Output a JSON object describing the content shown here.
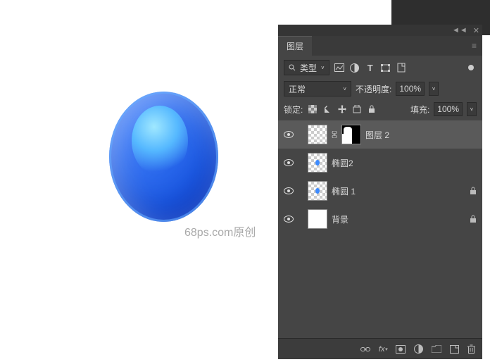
{
  "canvas": {
    "watermark": "68ps.com原创"
  },
  "panel": {
    "title": "图层",
    "filter": {
      "label": "类型",
      "icons": {
        "image": "image-filter-icon",
        "adjust": "adjustment-filter-icon",
        "text": "text-filter-icon",
        "shape": "shape-filter-icon",
        "smart": "smart-filter-icon"
      }
    },
    "blend": {
      "mode": "正常",
      "opacity_label": "不透明度:",
      "opacity_value": "100%"
    },
    "lock": {
      "label": "锁定:",
      "fill_label": "填充:",
      "fill_value": "100%"
    },
    "layers": [
      {
        "name": "图层 2",
        "linked_mask": true,
        "selected": true,
        "thumb": "transparent",
        "locked": false
      },
      {
        "name": "椭圆2",
        "thumb": "transparent-dot",
        "locked": false
      },
      {
        "name": "椭圆 1",
        "thumb": "transparent-dot",
        "locked": true
      },
      {
        "name": "背景",
        "thumb": "white",
        "locked": true
      }
    ],
    "footer": {
      "fx_label": "fx"
    }
  }
}
